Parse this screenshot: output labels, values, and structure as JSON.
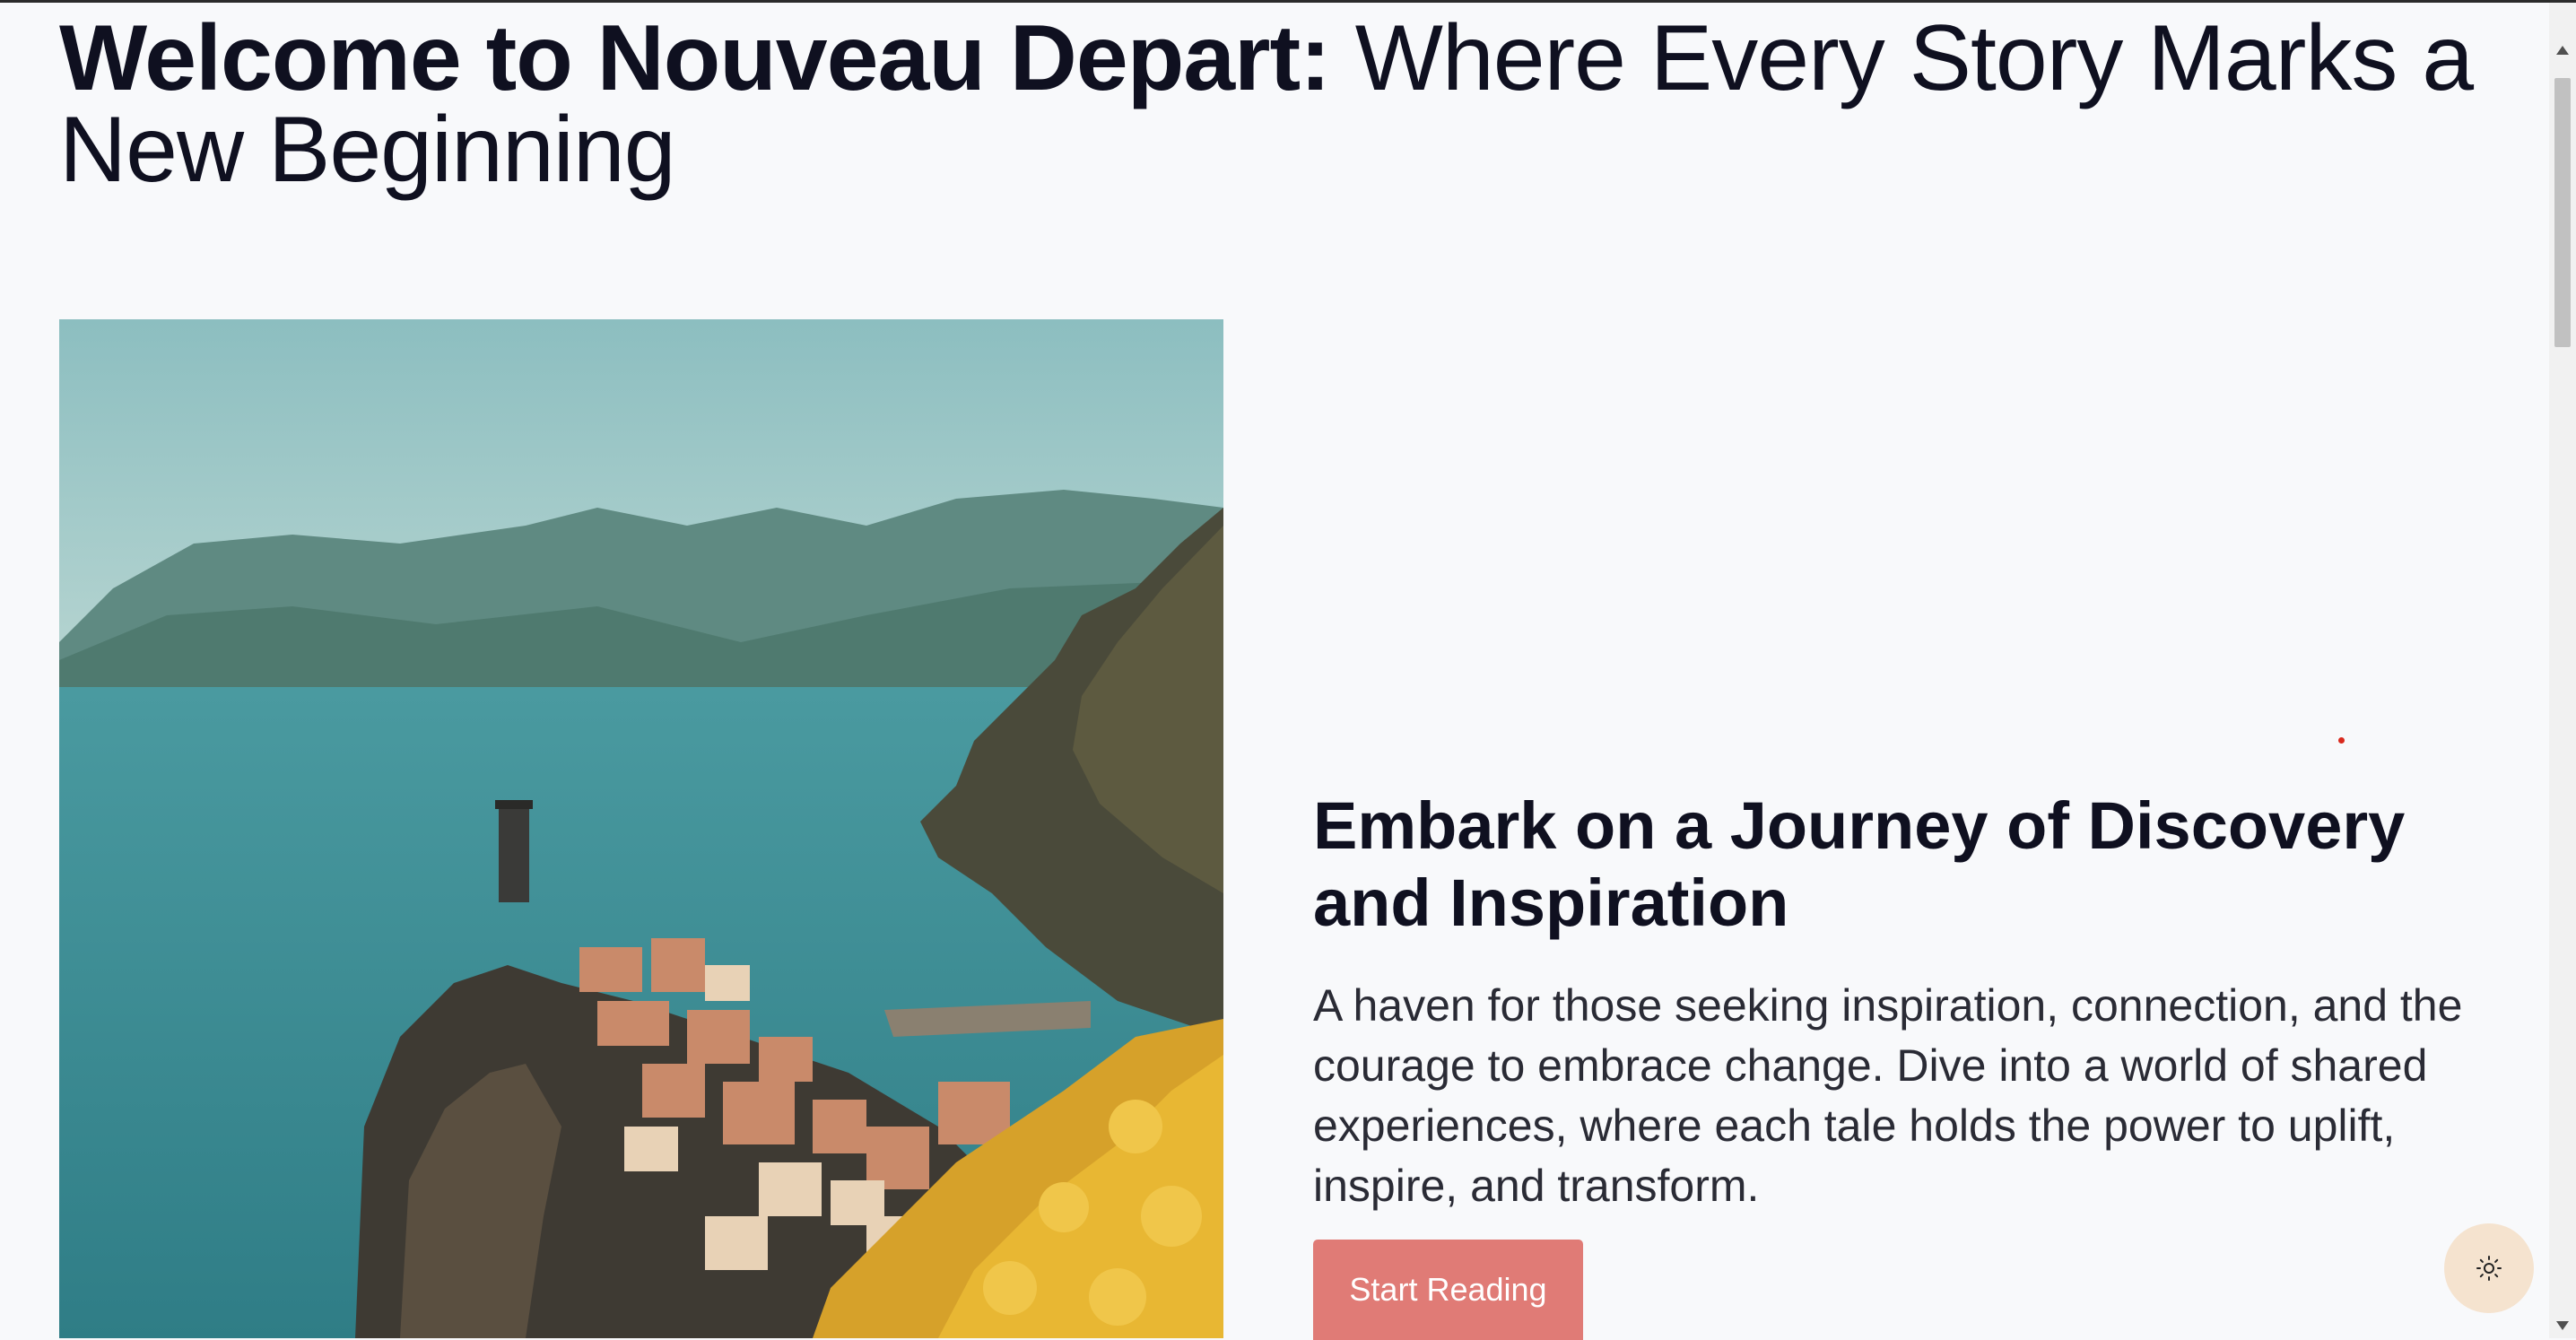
{
  "hero": {
    "title_bold": "Welcome to Nouveau Depart:",
    "title_light": " Where Every Story Marks a New Beginning"
  },
  "feature": {
    "title": "Embark on a Journey of Discovery and Inspiration",
    "description": "A haven for those seeking inspiration, connection, and the courage to embrace change. Dive into a world of shared experiences, where each tale holds the power to uplift, inspire, and transform.",
    "button_label": "Start Reading"
  },
  "icons": {
    "theme_toggle": "sun-icon"
  },
  "colors": {
    "background": "#f8f9fb",
    "accent": "#e07b76",
    "toggle_background": "#f5e3cf",
    "text": "#0f1020"
  }
}
